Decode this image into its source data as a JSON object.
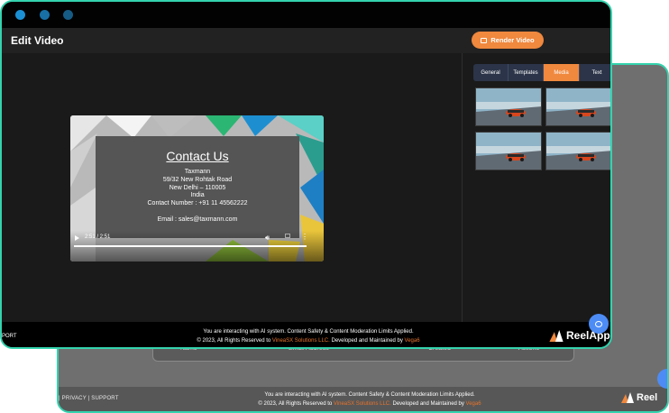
{
  "back_window": {
    "table_headers": [
      "Name",
      "Email Address",
      "Created",
      "Actions"
    ],
    "footer": {
      "links": "| PRIVACY | SUPPORT",
      "line1": "You are interacting with AI system. Content Safety & Content Moderation Limits Applied.",
      "line2_prefix": "© 2023, All Rights Reserved to ",
      "company": "VineaSX Solutions LLC.",
      "line2_mid": " Developed and Maintained by ",
      "developer": "Vega6",
      "logo_text": "Reel"
    }
  },
  "front_window": {
    "header": {
      "title": "Edit Video",
      "render_label": "Render Video"
    },
    "video": {
      "heading": "Contact Us",
      "lines": [
        "Taxmann",
        "59/32 New Rohtak Road",
        "New Delhi – 110005",
        "India",
        "Contact Number : +91 11 45562222",
        "",
        "Email : sales@taxmann.com"
      ],
      "time": "2:51 / 2:51",
      "progress": 1.0
    },
    "tabs": [
      {
        "label": "General",
        "active": false
      },
      {
        "label": "Templates",
        "active": false
      },
      {
        "label": "Media",
        "active": true
      },
      {
        "label": "Text",
        "active": false
      }
    ],
    "footer": {
      "links": "PORT",
      "line1": "You are interacting with AI system. Content Safety & Content Moderation Limits Applied.",
      "line2_prefix": "© 2023, All Rights Reserved to ",
      "company": "VineaSX Solutions LLC.",
      "line2_mid": " Developed and Maintained by ",
      "developer": "Vega6",
      "logo_text": "ReelApp"
    }
  },
  "colors": {
    "accent": "#f0883e",
    "border": "#34d3ae",
    "chat": "#4d8cf5"
  }
}
